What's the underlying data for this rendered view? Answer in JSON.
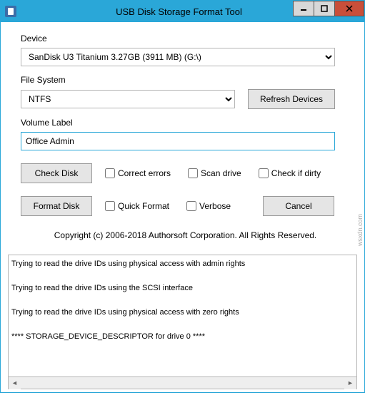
{
  "window": {
    "title": "USB Disk Storage Format Tool"
  },
  "labels": {
    "device": "Device",
    "file_system": "File System",
    "volume_label": "Volume Label"
  },
  "device": {
    "selected": "SanDisk U3 Titanium 3.27GB (3911 MB)  (G:\\)"
  },
  "file_system": {
    "selected": "NTFS"
  },
  "volume_label": {
    "value": "Office Admin"
  },
  "buttons": {
    "refresh_devices": "Refresh Devices",
    "check_disk": "Check Disk",
    "format_disk": "Format Disk",
    "cancel": "Cancel"
  },
  "checkboxes": {
    "correct_errors": "Correct errors",
    "scan_drive": "Scan drive",
    "check_if_dirty": "Check if dirty",
    "quick_format": "Quick Format",
    "verbose": "Verbose"
  },
  "copyright": "Copyright (c) 2006-2018 Authorsoft Corporation. All Rights Reserved.",
  "log": {
    "lines": [
      "Trying to read the drive IDs using physical access with admin rights",
      "Trying to read the drive IDs using the SCSI interface",
      "Trying to read the drive IDs using physical access with zero rights",
      "**** STORAGE_DEVICE_DESCRIPTOR for drive 0 ****"
    ]
  },
  "watermark": "wsxdn.com"
}
